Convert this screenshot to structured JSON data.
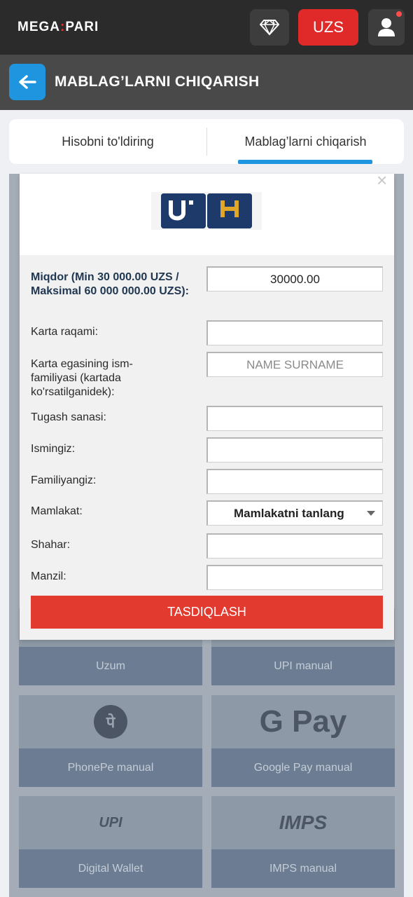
{
  "header": {
    "logo_left": "MEGA",
    "logo_right": "PARI",
    "currency": "UZS"
  },
  "page": {
    "title": "MABLAG’LARNI CHIQARISH"
  },
  "tabs": [
    {
      "label": "Hisobni to'ldiring"
    },
    {
      "label": "Mablag’larni chiqarish"
    }
  ],
  "form": {
    "close_symbol": "×",
    "rows": [
      {
        "label": "Miqdor (Min 30 000.00 UZS / Maksimal 60 000 000.00 UZS):",
        "value": "30000.00",
        "placeholder": ""
      },
      {
        "label": "Karta raqami:",
        "value": "",
        "placeholder": ""
      },
      {
        "label": "Karta egasining ism-familiyasi (kartada ko'rsatilganidek):",
        "value": "",
        "placeholder": "NAME SURNAME"
      },
      {
        "label": "Tugash sanasi:",
        "value": "",
        "placeholder": ""
      },
      {
        "label": "Ismingiz:",
        "value": "",
        "placeholder": ""
      },
      {
        "label": "Familiyangiz:",
        "value": "",
        "placeholder": ""
      },
      {
        "label": "Mamlakat:",
        "value": "Mamlakatni tanlang",
        "placeholder": ""
      },
      {
        "label": "Shahar:",
        "value": "",
        "placeholder": ""
      },
      {
        "label": "Manzil:",
        "value": "",
        "placeholder": ""
      }
    ],
    "submit_label": "TASDIQLASH"
  },
  "payment_methods": [
    {
      "label": "Uzum"
    },
    {
      "label": "UPI manual"
    },
    {
      "label": "PhonePe manual"
    },
    {
      "label": "Google Pay manual"
    },
    {
      "label": "Digital Wallet"
    },
    {
      "label": "IMPS manual"
    }
  ],
  "logos": {
    "gpay_text": "G Pay",
    "upi_text": "UPI",
    "imps_text": "IMPS",
    "phonepe_glyph": "पे"
  },
  "colors": {
    "accent": "#1f95e0",
    "brand_red": "#e33a2f"
  }
}
